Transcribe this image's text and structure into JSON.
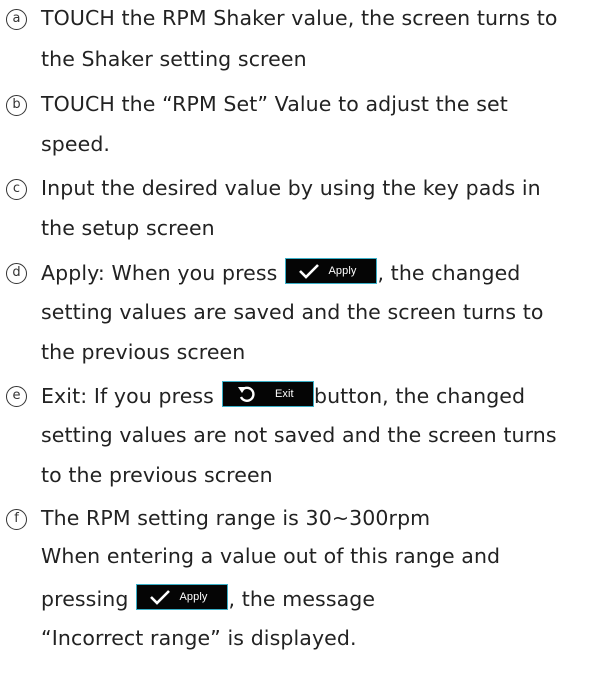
{
  "items": [
    {
      "marker": "a",
      "lines": [
        "TOUCH the RPM Shaker value, the screen turns to",
        "the Shaker setting screen"
      ]
    },
    {
      "marker": "b",
      "lines": [
        "TOUCH the “RPM Set” Value to adjust the set",
        "speed."
      ]
    },
    {
      "marker": "c",
      "lines": [
        "Input the desired value by using the key pads in",
        "the setup screen"
      ]
    },
    {
      "marker": "d",
      "line1_before": "Apply: When you press",
      "line1_after": ", the changed",
      "lines_rest": [
        "setting values are saved and the screen turns to",
        "the previous screen"
      ]
    },
    {
      "marker": "e",
      "line1_before": "Exit: If you press",
      "line1_after": "button, the changed",
      "lines_rest": [
        "setting values are not saved and the screen turns",
        "to the previous screen"
      ]
    },
    {
      "marker": "f",
      "lines_top": [
        "The RPM setting range is 30~300rpm",
        "When entering a value out of this range and"
      ],
      "pressing_before": "pressing",
      "pressing_after": ", the message",
      "lines_bottom": [
        "“Incorrect range” is displayed."
      ]
    }
  ],
  "buttons": {
    "apply_label": "Apply",
    "exit_label": "Exit",
    "apply_icon": "checkmark-icon",
    "exit_icon": "undo-arrow-icon",
    "background": "#050505",
    "border": "#3ab0c8"
  }
}
